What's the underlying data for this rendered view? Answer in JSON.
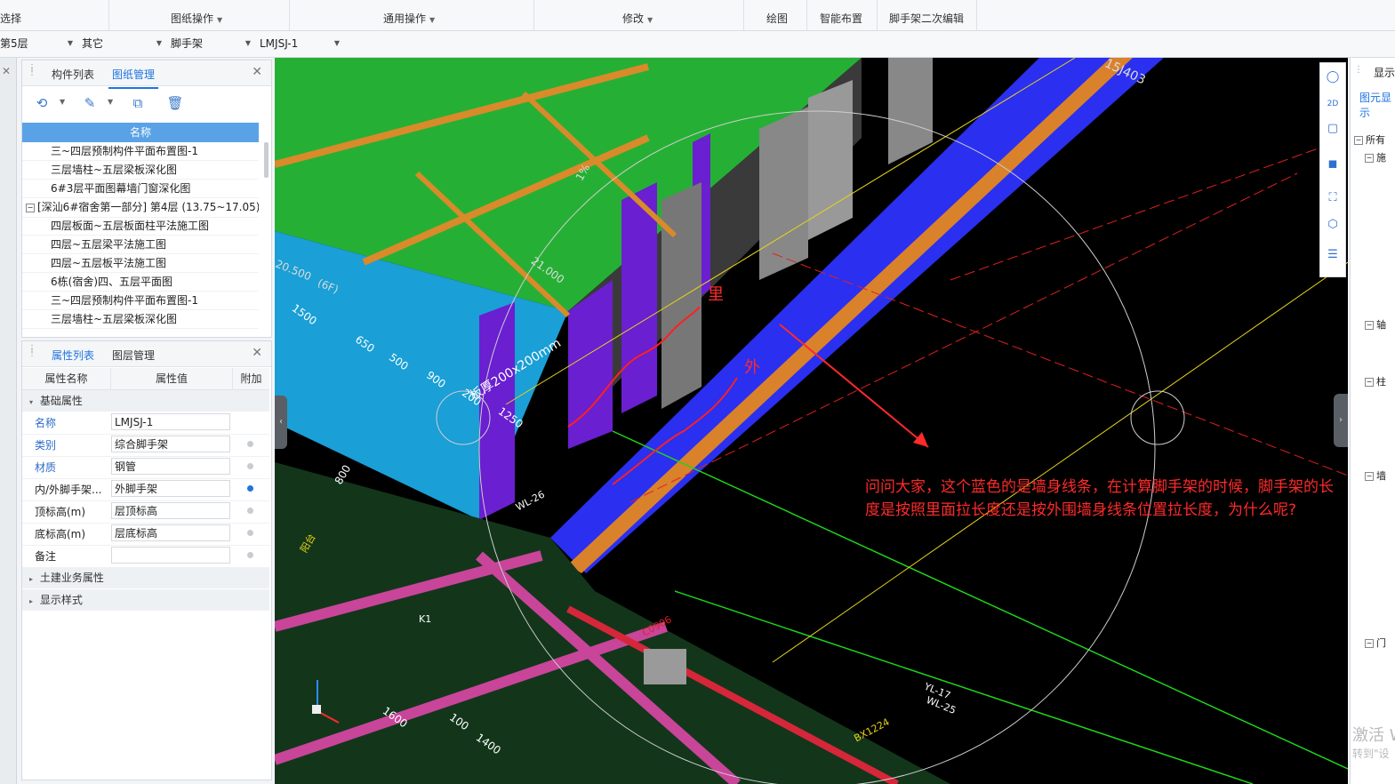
{
  "ribbon": {
    "left_label": "选择",
    "groups": [
      "图纸操作",
      "通用操作",
      "修改",
      "绘图",
      "智能布置",
      "脚手架二次编辑"
    ]
  },
  "selectors": {
    "floor": "第5层",
    "category": "其它",
    "type": "脚手架",
    "component": "LMJSJ-1"
  },
  "drawing_panel": {
    "tabs": [
      "构件列表",
      "图纸管理"
    ],
    "active_tab": "图纸管理",
    "column_header": "名称",
    "rows": [
      "三~四层预制构件平面布置图-1",
      "三层墙柱~五层梁板深化图",
      "6#3层平面图幕墙门窗深化图",
      "[深汕6#宿舍第一部分] 第4层 (13.75~17.05)",
      "四层板面~五层板面柱平法施工图",
      "四层~五层梁平法施工图",
      "四层~五层板平法施工图",
      "6栋(宿舍)四、五层平面图",
      "三~四层预制构件平面布置图-1",
      "三层墙柱~五层梁板深化图"
    ],
    "group_toggle": "−"
  },
  "property_panel": {
    "tabs": [
      "属性列表",
      "图层管理"
    ],
    "active_tab": "属性列表",
    "headers": [
      "属性名称",
      "属性值",
      "附加"
    ],
    "section_basic": "基础属性",
    "rows": [
      {
        "name": "名称",
        "value": "LMJSJ-1"
      },
      {
        "name": "类别",
        "value": "综合脚手架"
      },
      {
        "name": "材质",
        "value": "钢管"
      },
      {
        "name": "内/外脚手架...",
        "value": "外脚手架"
      },
      {
        "name": "顶标高(m)",
        "value": "层顶标高"
      },
      {
        "name": "底标高(m)",
        "value": "层底标高"
      },
      {
        "name": "备注",
        "value": ""
      }
    ],
    "section_civil": "土建业务属性",
    "section_display": "显示样式"
  },
  "viewport": {
    "annotation": "问问大家，这个蓝色的是墙身线条，在计算脚手架的时候，脚手架的长度是按照里面拉长度还是按外围墙身线条位置拉长度，为什么呢?",
    "label_inner": "里",
    "label_outer": "外",
    "cad_texts": [
      "15J403",
      "20.500",
      "(6F)",
      "1500",
      "650",
      "500",
      "900",
      "200",
      "1250",
      "1%",
      "21.000",
      "800",
      "1600",
      "100",
      "1400",
      "BX1224",
      "WL-26",
      "C0906",
      "K1",
      "阳台",
      "YL-17",
      "WL-25"
    ],
    "slab_note": "板厚200x200mm",
    "watermark": [
      "激活 W",
      "转到\"设"
    ]
  },
  "right_panel": {
    "title": "显示",
    "tab": "图元显示",
    "items": [
      "所有",
      "施",
      "轴",
      "柱",
      "墙",
      "门"
    ]
  },
  "colors": {
    "accent": "#1f74e0",
    "table_header": "#5aa2e6",
    "annotation_red": "#ff2a2a"
  }
}
